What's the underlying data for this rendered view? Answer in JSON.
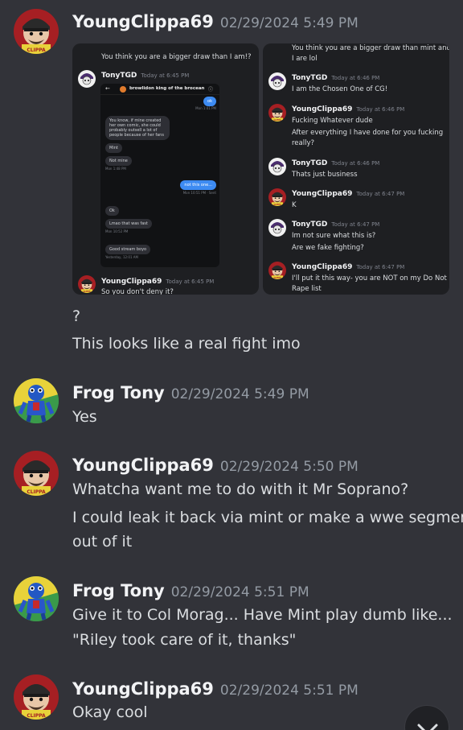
{
  "messages": [
    {
      "author": "YoungClippa69",
      "timestamp": "02/29/2024 5:49 PM",
      "lines": [
        "?",
        "This looks like a real fight imo"
      ],
      "attachment_left": {
        "caption_top": "You think you are a bigger draw than I am!?",
        "embed_author": "TonyTGD",
        "embed_time": "Today at 6:45 PM",
        "phone": {
          "header": "browlidon king of the brocean",
          "bubbles": [
            "ok",
            "You know, if mine created her own comic, she could probably outsell a lot of people because of her fans",
            "Mint",
            "Not mine",
            "not this one...",
            "Ok",
            "Lmao that was fast",
            "Good stream boyo"
          ],
          "stamps": [
            "Mon 1:41 PM",
            "Mon 1:48 PM",
            "Mon 10:51 PM · Sent",
            "Mon 10:52 PM",
            "Yesterday, 12:01 AM"
          ]
        },
        "bottom_author": "YoungClippa69",
        "bottom_time": "Today at 6:45 PM",
        "bottom_text": "So you don't deny it?"
      },
      "attachment_right": {
        "top_text": [
          "You think you are a bigger draw than mint and",
          "I are lol"
        ],
        "entries": [
          {
            "author": "TonyTGD",
            "time": "Today at 6:46 PM",
            "lines": [
              "I am the Chosen One of CG!"
            ]
          },
          {
            "author": "YoungClippa69",
            "time": "Today at 6:46 PM",
            "lines": [
              "Fucking Whatever dude",
              "After everything I have done for you fucking",
              "really?"
            ]
          },
          {
            "author": "TonyTGD",
            "time": "Today at 6:46 PM",
            "lines": [
              "Thats just business"
            ]
          },
          {
            "author": "YoungClippa69",
            "time": "Today at 6:47 PM",
            "lines": [
              "K"
            ]
          },
          {
            "author": "TonyTGD",
            "time": "Today at 6:47 PM",
            "lines": [
              "Im not sure what this is?",
              "Are we fake fighting?"
            ]
          },
          {
            "author": "YoungClippa69",
            "time": "Today at 6:47 PM",
            "lines": [
              "I'll put it this way- you are NOT on my Do Not",
              "Rape list"
            ]
          }
        ]
      }
    },
    {
      "author": "Frog Tony",
      "timestamp": "02/29/2024 5:49 PM",
      "lines": [
        "Yes"
      ]
    },
    {
      "author": "YoungClippa69",
      "timestamp": "02/29/2024 5:50 PM",
      "lines": [
        "Whatcha want me to do with it Mr Soprano?",
        "I could leak it back via mint or make a wwe segment",
        "out of it"
      ]
    },
    {
      "author": "Frog Tony",
      "timestamp": "02/29/2024 5:51 PM",
      "lines": [
        "Give it to Col Morag... Have Mint play dumb like...",
        "\"Riley took care of it, thanks\""
      ]
    },
    {
      "author": "YoungClippa69",
      "timestamp": "02/29/2024 5:51 PM",
      "lines": [
        "Okay cool"
      ]
    }
  ],
  "icons": {
    "scroll_button": "chevron-down-icon",
    "clippa_avatar": "cartoon-avatar-icon",
    "frog_avatar": "frog-avatar-icon",
    "tony_avatar": "skull-avatar-icon"
  },
  "colors": {
    "background": "#323339",
    "username": "#f2f3f5",
    "timestamp": "#949ba4",
    "text": "#dbdee1"
  }
}
